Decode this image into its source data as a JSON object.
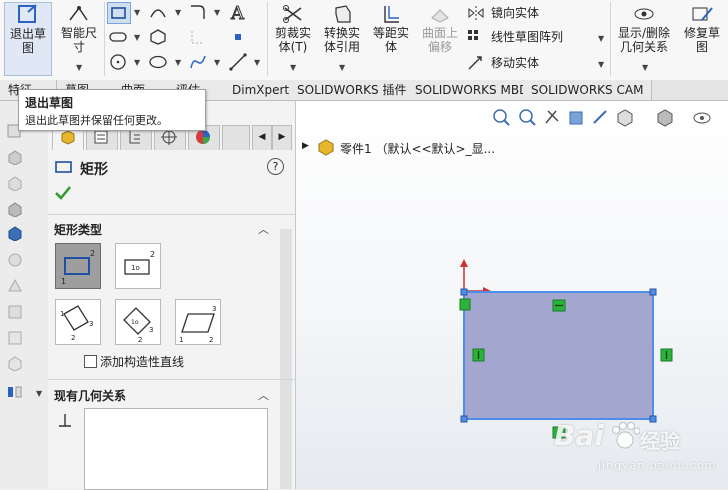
{
  "ribbon": {
    "exit_sketch": "退出草\n图",
    "smart_dim": "智能尺\n寸",
    "trim": "剪裁实\n体(T)",
    "convert": "转换实\n体引用",
    "offset": "等距实\n体",
    "surface_offset": "曲面上\n偏移",
    "mirror": "镜向实体",
    "linear_pattern": "线性草图阵列",
    "move": "移动实体",
    "show_delete": "显示/删除\n几何关系",
    "repair": "修复草\n图"
  },
  "tabs": [
    "特征",
    "草图",
    "曲面",
    "评估",
    "DimXpert",
    "SOLIDWORKS 插件",
    "SOLIDWORKS MBD",
    "SOLIDWORKS CAM"
  ],
  "tooltip": {
    "title": "退出草图",
    "desc": "退出此草图并保留任何更改。"
  },
  "pm": {
    "title": "矩形",
    "help": "?",
    "rect_type_label": "矩形类型",
    "construction_label": "添加构造性直线",
    "relations_label": "现有几何关系"
  },
  "tree": {
    "root": "零件1 （默认<<默认>_显..."
  },
  "watermark": {
    "brand": "Bai",
    "brand2": "经验",
    "url": "jingyan.baidu.com"
  },
  "colors": {
    "accent": "#2b63c5",
    "rect_fill": "#a3a7cf",
    "rect_edge": "#4f8ee8",
    "relation": "#2bb33a",
    "check": "#2e9a2e"
  }
}
